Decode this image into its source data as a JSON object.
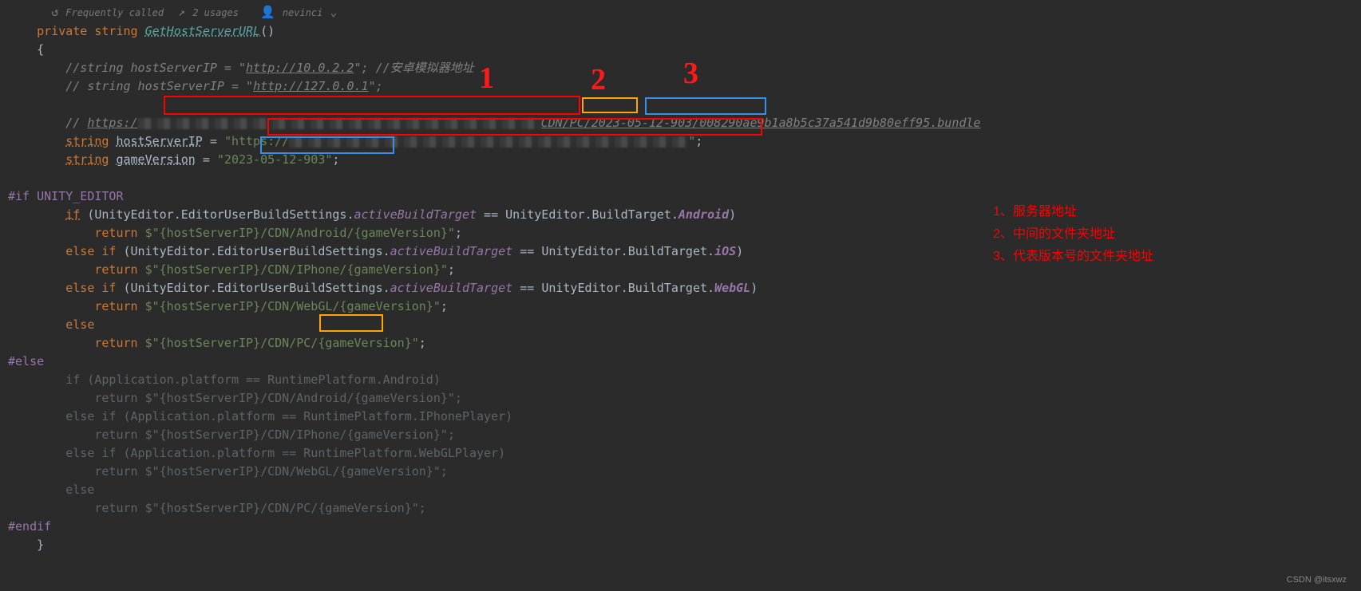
{
  "hints": {
    "freq": "Frequently called",
    "usages": "2 usages",
    "author": "nevinci"
  },
  "signature": {
    "private": "private",
    "string_kw": "string",
    "method": "GetHostServerURL",
    "open_brace": "{",
    "close_brace": "}"
  },
  "comments": {
    "c1a": "//string hostServerIP = \"",
    "c1b": "http://10.0.2.2",
    "c1c": "\"; //安卓模拟器地址",
    "c2a": "// string hostServerIP = \"",
    "c2b": "http://127.0.0.1",
    "c2c": "\";",
    "c3a": "// ",
    "c3b": "https:/",
    "c3mid": "CDN/PC",
    "c3sep": "/",
    "c3date": "2023-05-12-903",
    "c3tail": "/008290ae9b1a8b5c37a541d9b80eff95.bundle"
  },
  "decl": {
    "string_kw": "string",
    "host_var": "hostServerIP",
    "eq": " = ",
    "host_val_pre": "\"https://",
    "host_val_post": "\"",
    "semi": ";",
    "ver_var": "gameVersion",
    "ver_val": "\"2023-05-12-903\""
  },
  "pp": {
    "if_editor": "#if UNITY_EDITOR",
    "else": "#else",
    "endif": "#endif"
  },
  "editor_block": {
    "if_kw": "if",
    "else_if_kw": "else if",
    "else_kw": "else",
    "return_kw": "return",
    "ue": "UnityEditor",
    "eubs": "EditorUserBuildSettings",
    "abt": "activeBuildTarget",
    "bt": "BuildTarget",
    "android": "Android",
    "ios": "iOS",
    "webgl": "WebGL",
    "ret_android": "$\"{hostServerIP}/CDN/Android/{gameVersion}\"",
    "ret_iphone": "$\"{hostServerIP}/CDN/IPhone/{gameVersion}\"",
    "ret_webgl": "$\"{hostServerIP}/CDN/WebGL/{gameVersion}\"",
    "ret_pc_pre": "$\"{hostServerIP}/",
    "ret_pc_mid": "CDN/PC/",
    "ret_pc_post": "{gameVersion}\""
  },
  "else_block": {
    "l1": "        if (Application.platform == RuntimePlatform.Android)",
    "l2": "            return $\"{hostServerIP}/CDN/Android/{gameVersion}\";",
    "l3": "        else if (Application.platform == RuntimePlatform.IPhonePlayer)",
    "l4": "            return $\"{hostServerIP}/CDN/IPhone/{gameVersion}\";",
    "l5": "        else if (Application.platform == RuntimePlatform.WebGLPlayer)",
    "l6": "            return $\"{hostServerIP}/CDN/WebGL/{gameVersion}\";",
    "l7": "        else",
    "l8": "            return $\"{hostServerIP}/CDN/PC/{gameVersion}\";"
  },
  "handwritten": {
    "one": "1",
    "two": "2",
    "three": "3"
  },
  "notes": {
    "n1": "1、服务器地址",
    "n2": "2、中间的文件夹地址",
    "n3": "3、代表版本号的文件夹地址"
  },
  "watermark": "CSDN @itsxwz"
}
